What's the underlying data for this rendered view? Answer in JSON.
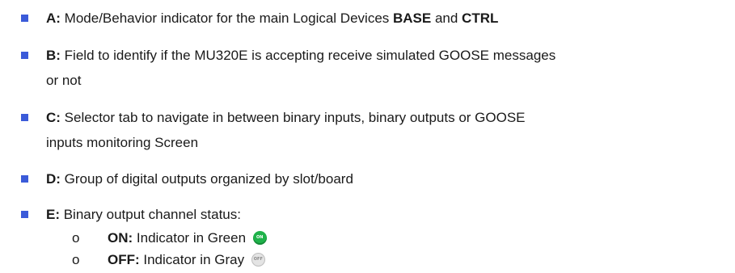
{
  "items": [
    {
      "key": "A:",
      "pre": " Mode/Behavior indicator for the main Logical Devices ",
      "b1": "BASE",
      "mid": " and ",
      "b2": "CTRL"
    },
    {
      "key": "B:",
      "line1": " Field to identify if the MU320E is accepting receive simulated GOOSE messages",
      "line2": "or not"
    },
    {
      "key": "C:",
      "line1": " Selector tab to navigate in between binary inputs, binary outputs or GOOSE",
      "line2": "inputs monitoring Screen"
    },
    {
      "key": "D:",
      "text": " Group of digital outputs organized by slot/board"
    },
    {
      "key": "E:",
      "text": " Binary output channel status:"
    }
  ],
  "subitems": [
    {
      "marker": "o",
      "key": "ON:",
      "text": " Indicator in Green",
      "icon": "on-indicator-icon",
      "icon_label": "ON",
      "color": "#1fb24a"
    },
    {
      "marker": "o",
      "key": "OFF:",
      "text": " Indicator in Gray",
      "icon": "off-indicator-icon",
      "icon_label": "OFF",
      "color": "#e4e4e4"
    }
  ],
  "colors": {
    "bullet": "#3b5bd9",
    "text": "#1a1a1a"
  }
}
